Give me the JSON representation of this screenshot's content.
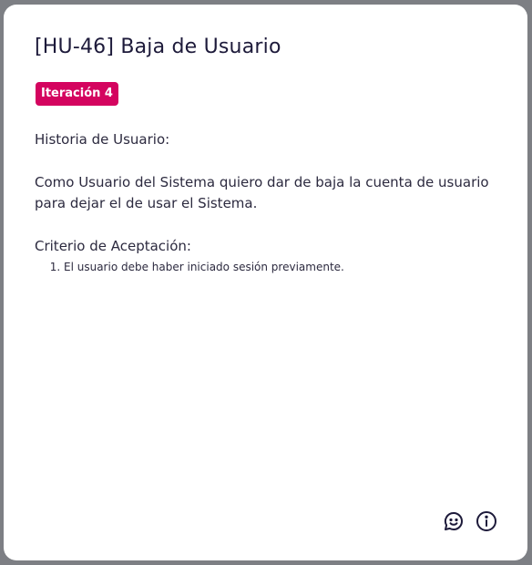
{
  "card": {
    "title": "[HU-46] Baja de Usuario",
    "badge": "Iteración 4",
    "badge_color": "#d4045f",
    "story_label": "Historia de Usuario:",
    "story_text": "Como Usuario del Sistema quiero dar de baja la cuenta de usuario para dejar el de usar el Sistema.",
    "criteria_label": "Criterio de Aceptación:",
    "criteria": [
      "El usuario debe haber iniciado sesión previamente."
    ]
  },
  "actions": {
    "comments_icon": "chat-smile-icon",
    "info_icon": "info-icon"
  }
}
